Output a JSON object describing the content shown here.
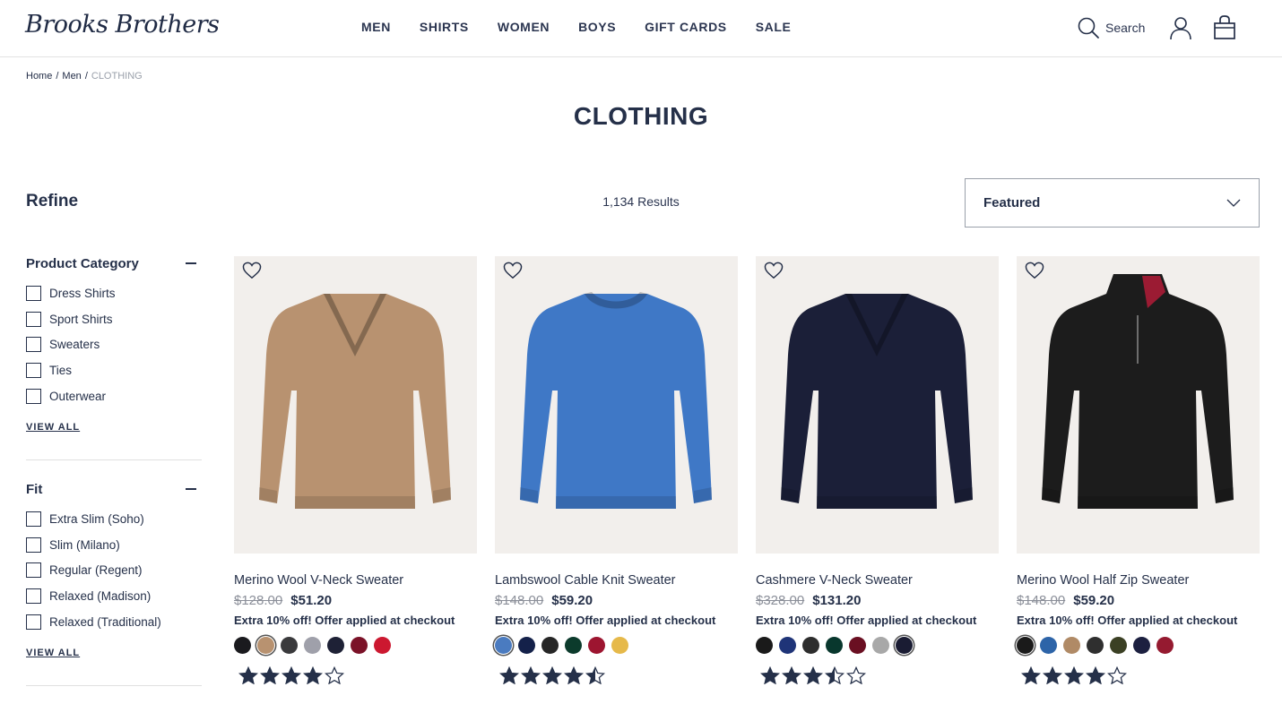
{
  "header": {
    "logo": "Brooks Brothers",
    "nav": [
      "MEN",
      "SHIRTS",
      "WOMEN",
      "BOYS",
      "GIFT CARDS",
      "SALE"
    ],
    "search_label": "Search"
  },
  "breadcrumb": {
    "home": "Home",
    "men": "Men",
    "current": "CLOTHING"
  },
  "page_title": "CLOTHING",
  "refine_title": "Refine",
  "results_count": "1,134 Results",
  "sort": {
    "selected": "Featured"
  },
  "filters": [
    {
      "title": "Product Category",
      "options": [
        "Dress Shirts",
        "Sport Shirts",
        "Sweaters",
        "Ties",
        "Outerwear"
      ],
      "view_all": "VIEW ALL"
    },
    {
      "title": "Fit",
      "options": [
        "Extra Slim (Soho)",
        "Slim (Milano)",
        "Regular (Regent)",
        "Relaxed (Madison)",
        "Relaxed (Traditional)"
      ],
      "view_all": "VIEW ALL"
    }
  ],
  "products": [
    {
      "name": "Merino Wool V-Neck Sweater",
      "original_price": "$128.00",
      "sale_price": "$51.20",
      "promo": "Extra 10% off! Offer applied at checkout",
      "garment_color": "#b89270",
      "style": "vneck",
      "swatches": [
        "#1a1a1e",
        "#b89270",
        "#3a3a3c",
        "#9fa0aa",
        "#1e2136",
        "#7b1228",
        "#cc1830"
      ],
      "selected_swatch": 1,
      "rating": 4
    },
    {
      "name": "Lambswool Cable Knit Sweater",
      "original_price": "$148.00",
      "sale_price": "$59.20",
      "promo": "Extra 10% off! Offer applied at checkout",
      "garment_color": "#3f78c6",
      "style": "crew",
      "swatches": [
        "#4a7bc0",
        "#14214a",
        "#262626",
        "#0c3b2c",
        "#9d1530",
        "#e6b94a"
      ],
      "selected_swatch": 0,
      "rating": 4.5
    },
    {
      "name": "Cashmere V-Neck Sweater",
      "original_price": "$328.00",
      "sale_price": "$131.20",
      "promo": "Extra 10% off! Offer applied at checkout",
      "garment_color": "#1b1f38",
      "style": "vneck",
      "swatches": [
        "#1a1a1a",
        "#1f3478",
        "#2d2d2d",
        "#08372d",
        "#6a0f22",
        "#a8a8a8",
        "#1a1c33"
      ],
      "selected_swatch": 6,
      "rating": 3.5
    },
    {
      "name": "Merino Wool Half Zip Sweater",
      "original_price": "$148.00",
      "sale_price": "$59.20",
      "promo": "Extra 10% off! Offer applied at checkout",
      "garment_color": "#1c1c1c",
      "style": "zip",
      "swatches": [
        "#1a1a1a",
        "#2d64a8",
        "#b08a66",
        "#2f2f2f",
        "#3b4024",
        "#1c2040",
        "#951a30"
      ],
      "selected_swatch": 0,
      "rating": 4
    }
  ]
}
